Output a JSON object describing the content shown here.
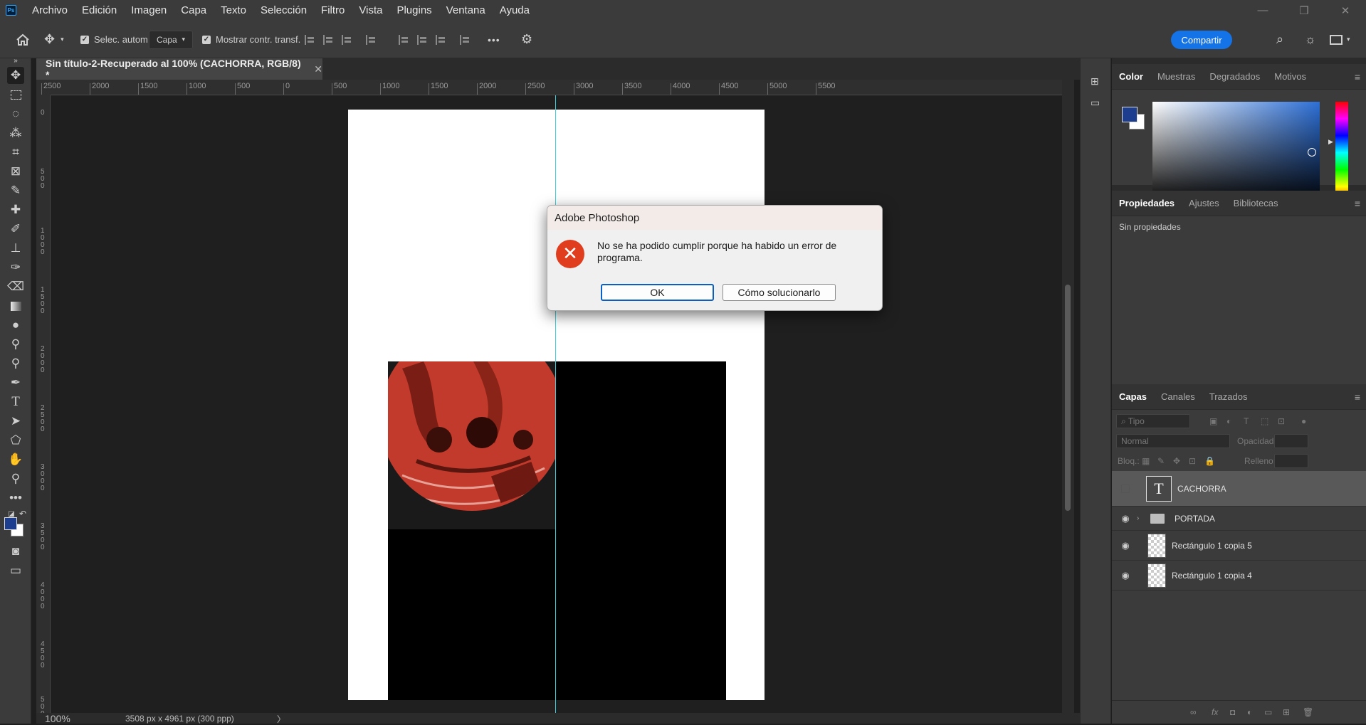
{
  "app": {
    "logo": "Ps"
  },
  "menu": [
    "Archivo",
    "Edición",
    "Imagen",
    "Capa",
    "Texto",
    "Selección",
    "Filtro",
    "Vista",
    "Plugins",
    "Ventana",
    "Ayuda"
  ],
  "window_controls": {
    "minimize": "—",
    "maximize": "❐",
    "close": "✕"
  },
  "options_bar": {
    "auto_select_label": "Selec. autom.:",
    "auto_select_checked": true,
    "auto_select_target": "Capa",
    "show_transform_label": "Mostrar contr. transf.",
    "show_transform_checked": true,
    "more": "•••",
    "share_label": "Compartir"
  },
  "document_tab": {
    "title": "Sin título-2-Recuperado al 100% (CACHORRA, RGB/8) *",
    "close": "✕"
  },
  "ruler": {
    "h_ticks": [
      "2500",
      "2000",
      "1500",
      "1000",
      "500",
      "0",
      "500",
      "1000",
      "1500",
      "2000",
      "2500",
      "3000",
      "3500",
      "4000",
      "4500",
      "5000",
      "5500"
    ],
    "v_ticks": [
      "0",
      "500",
      "1000",
      "1500",
      "2000",
      "2500",
      "3000",
      "3500",
      "4000",
      "4500",
      "5000",
      "5"
    ]
  },
  "status": {
    "zoom": "100%",
    "doc_info": "3508 px x 4961 px (300 ppp)",
    "arrow": "〉"
  },
  "colors": {
    "foreground": "#1d3d8e",
    "background": "#ffffff",
    "accent": "#1473e6",
    "guide": "#3ad0e0",
    "error": "#e03c1e"
  },
  "color_panel": {
    "tabs": [
      "Color",
      "Muestras",
      "Degradados",
      "Motivos"
    ],
    "active": "Color"
  },
  "properties_panel": {
    "tabs": [
      "Propiedades",
      "Ajustes",
      "Bibliotecas"
    ],
    "active": "Propiedades",
    "content": "Sin propiedades"
  },
  "layers_panel": {
    "tabs": [
      "Capas",
      "Canales",
      "Trazados"
    ],
    "active": "Capas",
    "filter_placeholder": "Tipo",
    "blend_mode": "Normal",
    "opacity_label": "Opacidad:",
    "lock_label": "Bloq.:",
    "fill_label": "Relleno:",
    "layers": [
      {
        "name": "CACHORRA",
        "type": "text",
        "visible": false,
        "selected": true
      },
      {
        "name": "PORTADA",
        "type": "group",
        "visible": true,
        "selected": false
      },
      {
        "name": "Rectángulo 1 copia 5",
        "type": "shape",
        "visible": true,
        "selected": false
      },
      {
        "name": "Rectángulo 1 copia 4",
        "type": "shape",
        "visible": true,
        "selected": false
      }
    ]
  },
  "dialog": {
    "title": "Adobe Photoshop",
    "icon": "error-icon",
    "message": "No se ha podido cumplir porque ha habido un error de programa.",
    "ok_label": "OK",
    "help_label": "Cómo solucionarlo"
  }
}
